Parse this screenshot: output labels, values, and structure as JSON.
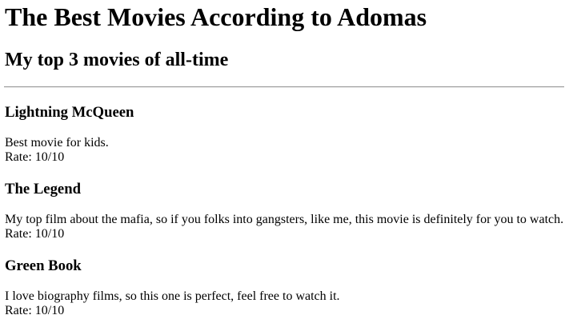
{
  "page": {
    "title": "The Best Movies According to Adomas",
    "subtitle": "My top 3 movies of all-time"
  },
  "movies": [
    {
      "title": "Lightning McQueen",
      "description": "Best movie for kids.",
      "rate": "Rate: 10/10"
    },
    {
      "title": "The Legend",
      "description": "My top film about the mafia, so if you folks into gangsters, like me, this movie is definitely for you to watch.",
      "rate": "Rate: 10/10"
    },
    {
      "title": "Green Book",
      "description": "I love biography films, so this one is perfect, feel free to watch it.",
      "rate": "Rate: 10/10"
    }
  ]
}
